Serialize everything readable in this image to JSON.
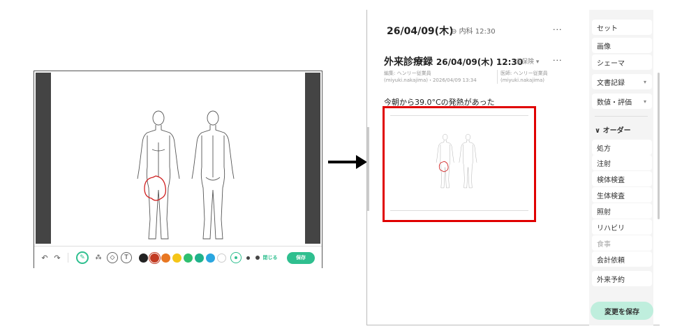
{
  "editor": {
    "toolbar": {
      "undo_icon": "undo-icon",
      "redo_icon": "redo-icon",
      "colors": [
        "#222222",
        "#c23b22",
        "#e87722",
        "#f5c518",
        "#2fbf6f",
        "#1fb28a",
        "#2aa6e0",
        "#ffffff"
      ],
      "selected_color": "#c23b22",
      "text_tool_label": "T",
      "close_label": "閉じる",
      "save_label": "保存"
    }
  },
  "record": {
    "header_date": "26/04/09(木)",
    "header_dept_time": "内科 12:30",
    "header_menu": "···",
    "title_label": "外来診療録",
    "title_datetime": "26/04/09(木) 12:30",
    "insurance": "主保険 ▾",
    "title_menu": "···",
    "editor_line1": "編集: ヘンリー従業員",
    "editor_line2": "(miyuki.nakajima)・2026/04/09 13:34",
    "doctor_line1": "医師: ヘンリー従業員",
    "doctor_line2": "(miyuki.nakajima)",
    "note_text": "今朝から39.0°Cの発熱があった"
  },
  "menu": {
    "top_items": [
      {
        "label": "セット"
      },
      {
        "label": "画像"
      },
      {
        "label": "シェーマ"
      },
      {
        "label": "文書記録",
        "caret": "▾"
      },
      {
        "label": "数値・評価",
        "caret": "▾"
      }
    ],
    "order_header": "∨ オーダー",
    "order_items": [
      {
        "label": "処方"
      },
      {
        "label": "注射"
      },
      {
        "label": "検体検査"
      },
      {
        "label": "生体検査"
      },
      {
        "label": "照射"
      },
      {
        "label": "リハビリ"
      },
      {
        "label": "食事",
        "disabled": true
      },
      {
        "label": "会計依頼"
      }
    ],
    "bottom_item": "外来予約",
    "save_changes_label": "変更を保存"
  },
  "accent_color": "#2fbf8f",
  "highlight_color": "#e00000"
}
